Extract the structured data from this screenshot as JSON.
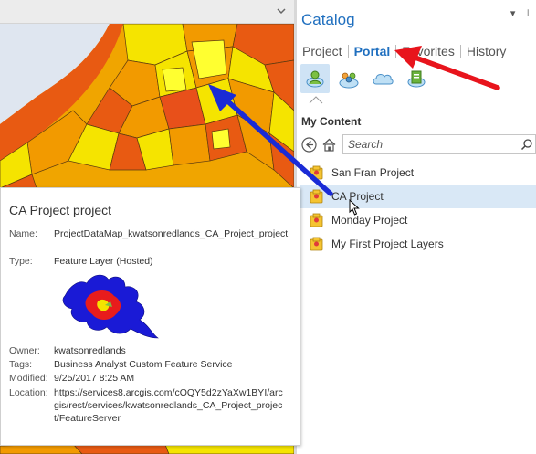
{
  "catalog": {
    "title": "Catalog",
    "controls": {
      "menu": "▾",
      "pin": "⊥"
    },
    "tabs": [
      {
        "label": "Project"
      },
      {
        "label": "Portal"
      },
      {
        "label": "Favorites"
      },
      {
        "label": "History"
      }
    ],
    "portal_icons": [
      {
        "name": "my-content-icon"
      },
      {
        "name": "groups-icon"
      },
      {
        "name": "cloud-icon"
      },
      {
        "name": "living-atlas-icon"
      }
    ],
    "section_label": "My Content",
    "search": {
      "placeholder": "Search"
    },
    "items": [
      {
        "label": "San Fran Project"
      },
      {
        "label": "CA Project"
      },
      {
        "label": "Monday Project"
      },
      {
        "label": "My First Project Layers"
      }
    ]
  },
  "tooltip": {
    "title": "CA Project project",
    "name_label": "Name:",
    "name_value": "ProjectDataMap_kwatsonredlands_CA_Project_project",
    "type_label": "Type:",
    "type_value": "Feature Layer (Hosted)",
    "owner_label": "Owner:",
    "owner_value": "kwatsonredlands",
    "tags_label": "Tags:",
    "tags_value": "Business Analyst Custom Feature Service",
    "modified_label": "Modified:",
    "modified_value": "9/25/2017 8:25 AM",
    "location_label": "Location:",
    "location_value": "https://services8.arcgis.com/cOQY5d2zYaXw1BYI/arcgis/rest/services/kwatsonredlands_CA_Project_project/FeatureServer"
  },
  "colors": {
    "accent": "#1f6fbf",
    "selected_row": "#d9e8f6",
    "arrow_red": "#e8141c",
    "arrow_blue": "#1a2bd6",
    "map_yellow": "#f5e400",
    "map_orange": "#f29a00",
    "map_red": "#e8501a"
  }
}
